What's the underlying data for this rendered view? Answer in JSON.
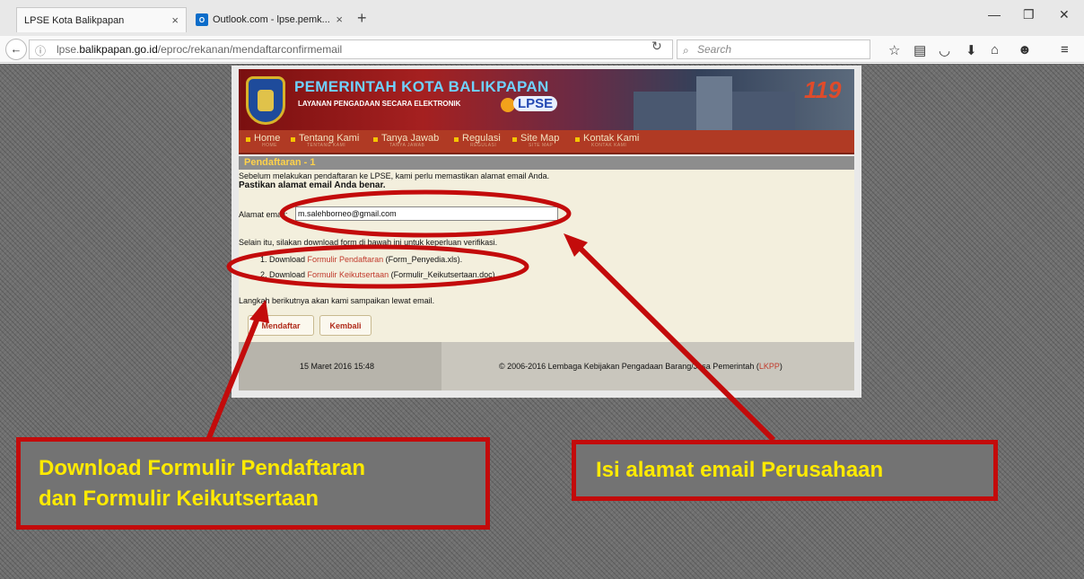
{
  "browser": {
    "tabs": [
      {
        "title": "LPSE Kota Balikpapan",
        "active": true
      },
      {
        "title": "Outlook.com - lpse.pemk...",
        "active": false
      }
    ],
    "tab_close_glyph": "×",
    "new_tab_glyph": "+",
    "url_prefix": "lpse.",
    "url_domain": "balikpapan.go.id",
    "url_path": "/eproc/rekanan/mendaftarconfirmemail",
    "search_placeholder": "Search",
    "window_controls": [
      "minimize-icon",
      "restore-icon",
      "close-icon"
    ],
    "toolbar_icons": [
      "star-icon",
      "reading-list-icon",
      "pocket-icon",
      "download-icon",
      "home-icon",
      "hello-icon",
      "menu-icon"
    ]
  },
  "site": {
    "header_title": "PEMERINTAH KOTA BALIKPAPAN",
    "header_subtitle": "LAYANAN PENGADAAN SECARA ELEKTRONIK",
    "lpse_logo": "LPSE",
    "badge": "119",
    "menu": [
      {
        "label": "Home",
        "sub": "HOME"
      },
      {
        "label": "Tentang Kami",
        "sub": "TENTANG KAMI"
      },
      {
        "label": "Tanya Jawab",
        "sub": "TANYA JAWAB"
      },
      {
        "label": "Regulasi",
        "sub": "REGULASI"
      },
      {
        "label": "Site Map",
        "sub": "SITE MAP"
      },
      {
        "label": "Kontak Kami",
        "sub": "KONTAK KAMI"
      }
    ],
    "section_title": "Pendaftaran - 1",
    "intro": "Sebelum melakukan pendaftaran ke LPSE, kami perlu memastikan alamat email Anda.",
    "emphasis": "Pastikan alamat email Anda benar.",
    "email_label": "Alamat email:",
    "email_value": "m.salehborneo@gmail.com",
    "download_intro": "Selain itu, silakan download form di bawah ini untuk keperluan verifikasi.",
    "downloads": [
      {
        "prefix": "1. Download ",
        "link": "Formulir Pendaftaran",
        "suffix": " (Form_Penyedia.xls)."
      },
      {
        "prefix": "2. Download ",
        "link": "Formulir Keikutsertaan",
        "suffix": " (Formulir_Keikutsertaan.doc)."
      }
    ],
    "next_step": "Langkah berikutnya akan kami sampaikan lewat email.",
    "buttons": {
      "register": "Mendaftar",
      "back": "Kembali"
    },
    "footer_date": "15 Maret 2016 15:48",
    "footer_copyright_pre": "© 2006-2016 Lembaga Kebijakan Pengadaan Barang/Jasa Pemerintah (",
    "footer_copyright_link": "LKPP",
    "footer_copyright_post": ")"
  },
  "annotations": {
    "left_line1": "Download Formulir Pendaftaran",
    "left_line2": "dan Formulir Keikutsertaan",
    "right": "Isi alamat email Perusahaan",
    "color": "#c30b0b",
    "text_color": "#ffea00"
  }
}
